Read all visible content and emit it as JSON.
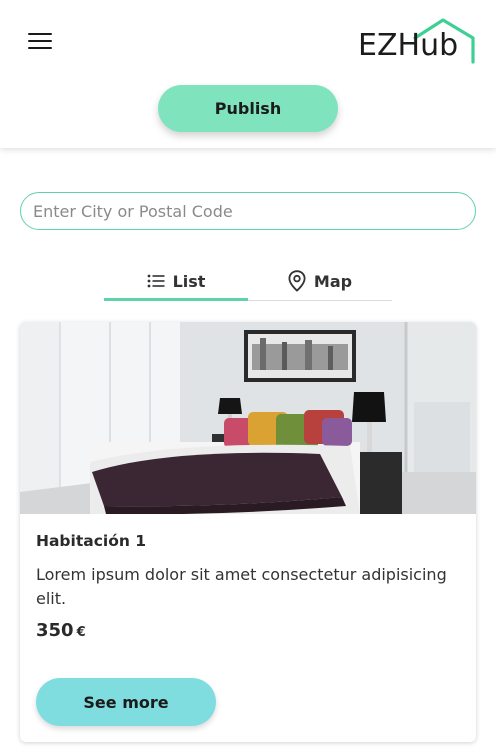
{
  "header": {
    "logo_text": "EZHub",
    "publish_label": "Publish"
  },
  "search": {
    "placeholder": "Enter City or Postal Code",
    "value": ""
  },
  "tabs": [
    {
      "label": "List",
      "icon": "list-icon",
      "active": true
    },
    {
      "label": "Map",
      "icon": "map-pin-icon",
      "active": false
    }
  ],
  "listing": {
    "title": "Habitación 1",
    "description": "Lorem ipsum dolor sit amet consectetur adipisicing elit.",
    "price": "350",
    "currency": "€",
    "see_more_label": "See more"
  },
  "colors": {
    "accent_green": "#7fe3bd",
    "accent_teal": "#7fdde0",
    "logo_roof": "#3ecf95"
  }
}
